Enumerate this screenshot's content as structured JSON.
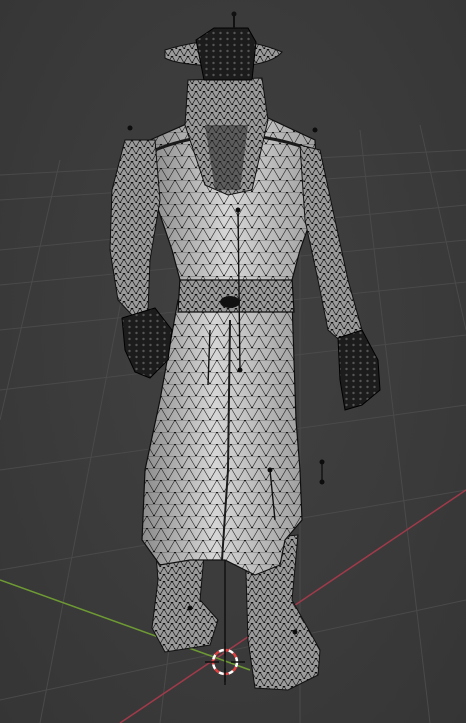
{
  "viewport": {
    "mode": "edit-mode-3d-viewport",
    "background_color": "#3b3b3b",
    "grid_color": "#4a4a4a",
    "x_axis_color": "#a03a4a",
    "y_axis_color": "#6e9a34",
    "mesh_fill_color": "#d9d9d9",
    "mesh_wire_color": "#1a1a1a",
    "vertex_color": "#111111"
  },
  "scene": {
    "object": "character-mesh",
    "description_icon": "mesh-object-icon"
  },
  "cursor_3d": {
    "icon": "3d-cursor-icon",
    "ring_color_a": "#e04040",
    "ring_color_b": "#ffffff"
  }
}
